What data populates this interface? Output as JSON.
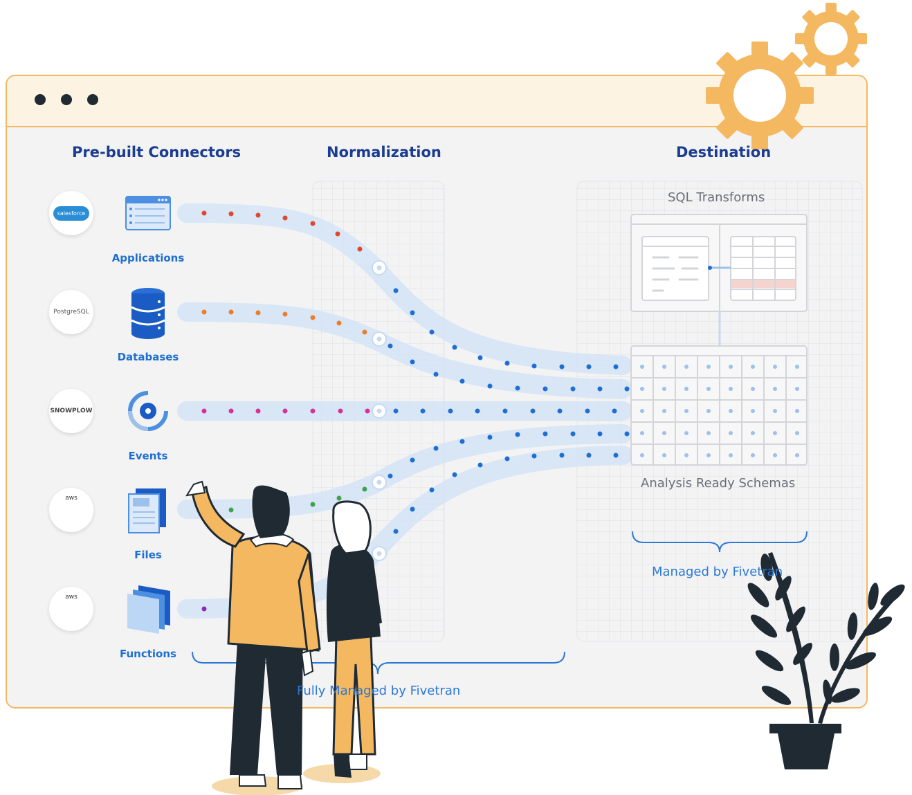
{
  "headings": {
    "connectors": "Pre-built Connectors",
    "normalization": "Normalization",
    "destination": "Destination"
  },
  "sources": [
    {
      "logo": "salesforce",
      "label": "Applications",
      "color": "#e0482b"
    },
    {
      "logo": "PostgreSQL",
      "label": "Databases",
      "color": "#ee7d2a"
    },
    {
      "logo": "SNOWPLOW",
      "label": "Events",
      "color": "#d6309a"
    },
    {
      "logo": "aws",
      "label": "Files",
      "color": "#3fa34d"
    },
    {
      "logo": "aws",
      "label": "Functions",
      "color": "#8b2bb8"
    }
  ],
  "destination": {
    "sql_transforms": "SQL Transforms",
    "analysis_ready": "Analysis Ready Schemas",
    "managed": "Managed  by Fivetran"
  },
  "footer": {
    "fully_managed": "Fully Managed by Fivetran"
  },
  "colors": {
    "accent": "#f4b860",
    "flow_blue": "#1f6fd1",
    "heading": "#1b3d8f"
  }
}
